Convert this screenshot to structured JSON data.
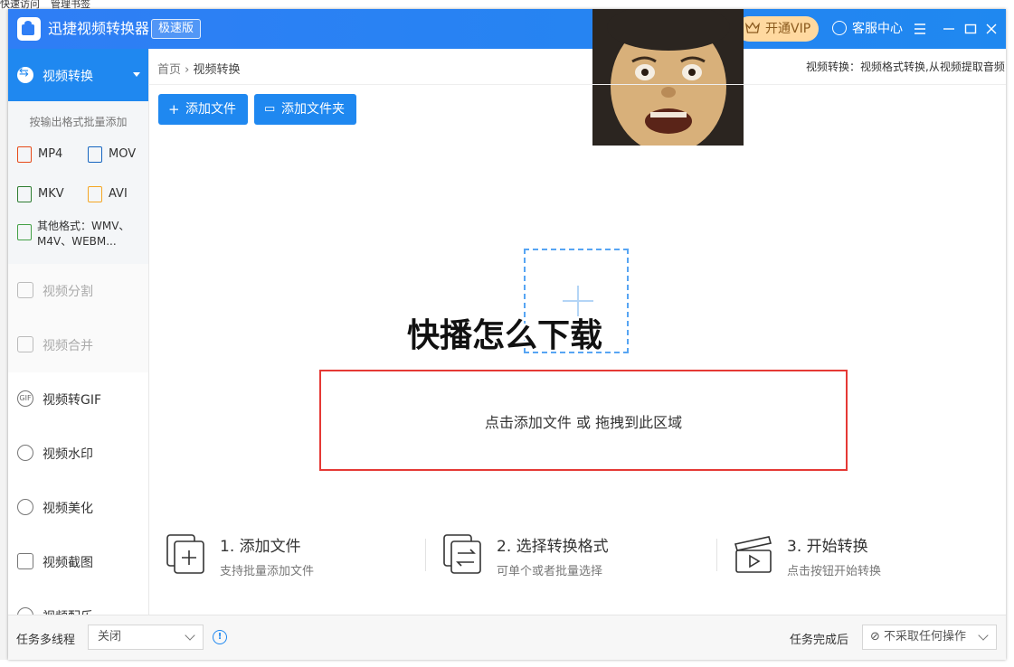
{
  "background": {
    "bookmarks": [
      "快速访问",
      "管理书签"
    ]
  },
  "titlebar": {
    "app_name": "迅捷视频转换器",
    "edition_badge": "极速版",
    "vip_label": "开通VIP",
    "service_label": "客服中心",
    "icons": [
      "crown-icon",
      "chat-icon",
      "menu-icon",
      "minimize-icon",
      "maximize-icon",
      "close-icon"
    ]
  },
  "sidebar": {
    "active": {
      "label": "视频转换",
      "icon": "convert-icon"
    },
    "format_hint": "按输出格式批量添加",
    "formats": [
      {
        "label": "MP4",
        "color": "#e64a19"
      },
      {
        "label": "MOV",
        "color": "#1565c0"
      },
      {
        "label": "MKV",
        "color": "#2e7d32"
      },
      {
        "label": "AVI",
        "color": "#f5a623"
      }
    ],
    "other_formats": {
      "line1": "其他格式：WMV、",
      "line2": "M4V、WEBM..."
    },
    "items": [
      {
        "label": "视频分割",
        "disabled": true
      },
      {
        "label": "视频合并",
        "disabled": true
      },
      {
        "label": "视频转GIF",
        "disabled": false
      },
      {
        "label": "视频水印",
        "disabled": false
      },
      {
        "label": "视频美化",
        "disabled": false
      },
      {
        "label": "视频截图",
        "disabled": false
      },
      {
        "label": "视频配乐",
        "disabled": false
      }
    ]
  },
  "breadcrumb": {
    "home": "首页",
    "separator": "›",
    "current": "视频转换"
  },
  "tagline": "视频转换：视频格式转换,从视频提取音频",
  "toolbar": {
    "add_file": "添加文件",
    "add_folder": "添加文件夹"
  },
  "overlay_caption": "快播怎么下载",
  "dropzone": {
    "text": "点击添加文件 或 拖拽到此区域"
  },
  "steps": [
    {
      "title": "1. 添加文件",
      "desc": "支持批量添加文件"
    },
    {
      "title": "2. 选择转换格式",
      "desc": "可单个或者批量选择"
    },
    {
      "title": "3. 开始转换",
      "desc": "点击按钮开始转换"
    }
  ],
  "footer": {
    "multithread_label": "任务多线程",
    "multithread_value": "关闭",
    "after_label": "任务完成后",
    "after_value": "不采取任何操作"
  },
  "colors": {
    "accent": "#1f88f0",
    "dropzone_border": "#e53935",
    "vip_bg": "#ffd9a0"
  }
}
